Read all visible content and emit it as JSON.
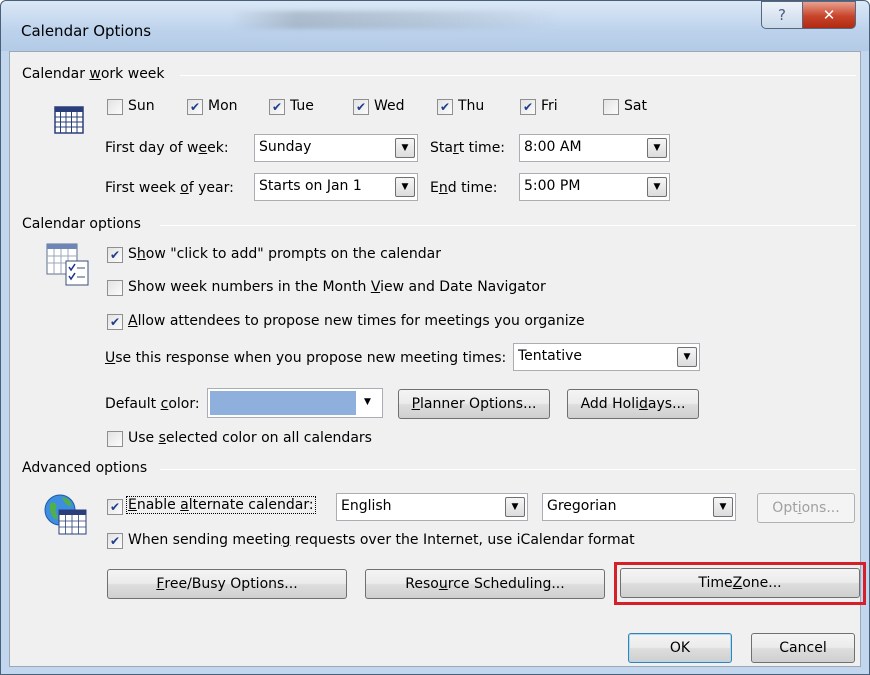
{
  "window": {
    "title": "Calendar Options",
    "help_glyph": "?",
    "close_glyph": "✕"
  },
  "work_week": {
    "group_label_pre": "Calendar ",
    "group_label_u": "w",
    "group_label_post": "ork week",
    "days": [
      {
        "label": "Sun",
        "checked": false
      },
      {
        "label": "Mon",
        "checked": true
      },
      {
        "label": "Tue",
        "checked": true
      },
      {
        "label": "Wed",
        "checked": true
      },
      {
        "label": "Thu",
        "checked": true
      },
      {
        "label": "Fri",
        "checked": true
      },
      {
        "label": "Sat",
        "checked": false
      }
    ],
    "first_day_label_pre": "First day of w",
    "first_day_label_u": "e",
    "first_day_label_post": "ek:",
    "first_day_value": "Sunday",
    "first_week_label_pre": "First week ",
    "first_week_label_u": "o",
    "first_week_label_post": "f year:",
    "first_week_value": "Starts on Jan 1",
    "start_time_label_pre": "Sta",
    "start_time_label_u": "r",
    "start_time_label_post": "t time:",
    "start_time_value": "8:00 AM",
    "end_time_label_pre": "E",
    "end_time_label_u": "n",
    "end_time_label_post": "d time:",
    "end_time_value": "5:00 PM"
  },
  "calendar_options": {
    "group_label": "Calendar options",
    "show_click_to_add_pre": "S",
    "show_click_to_add_u": "h",
    "show_click_to_add_post": "ow \"click to add\" prompts on the calendar",
    "show_click_to_add_checked": true,
    "show_week_numbers_pre": "Show week numbers in the Month ",
    "show_week_numbers_u": "V",
    "show_week_numbers_post": "iew and Date Navigator",
    "show_week_numbers_checked": false,
    "allow_attendees_pre": "",
    "allow_attendees_u": "A",
    "allow_attendees_post": "llow attendees to propose new times for meetings you organize",
    "allow_attendees_checked": true,
    "response_label_pre": "",
    "response_label_u": "U",
    "response_label_post": "se this response when you propose new meeting times:",
    "response_value": "Tentative",
    "default_color_label_pre": "Default ",
    "default_color_label_u": "c",
    "default_color_label_post": "olor:",
    "default_color_value": "#8fb0dc",
    "planner_options_pre": "",
    "planner_options_u": "P",
    "planner_options_post": "lanner Options...",
    "add_holidays_pre": "Add Holi",
    "add_holidays_u": "d",
    "add_holidays_post": "ays...",
    "use_selected_color_pre": "Use ",
    "use_selected_color_u": "s",
    "use_selected_color_post": "elected color on all calendars",
    "use_selected_color_checked": false
  },
  "advanced": {
    "group_label": "Advanced options",
    "enable_alt_pre": "",
    "enable_alt_u": "E",
    "enable_alt_post": "nable ",
    "enable_alt_u2": "a",
    "enable_alt_post2": "lternate calendar:",
    "enable_alt_checked": true,
    "language_value": "English",
    "calendar_value": "Gregorian",
    "options_pre": "Opt",
    "options_u": "i",
    "options_post": "ons...",
    "icalendar_pre": "When sending meetin",
    "icalendar_u": "g",
    "icalendar_post": " requests over the Internet, use iCalendar format",
    "icalendar_checked": true,
    "freebusy_pre": "",
    "freebusy_u": "F",
    "freebusy_post": "ree/Busy Options...",
    "resource_pre": "Reso",
    "resource_u": "u",
    "resource_post": "rce Scheduling...",
    "timezone_pre": "Time ",
    "timezone_u": "Z",
    "timezone_post": "one..."
  },
  "footer": {
    "ok_label": "OK",
    "cancel_label": "Cancel"
  },
  "colors": {
    "highlight": "#d5202a",
    "check": "#1f3e8c"
  }
}
